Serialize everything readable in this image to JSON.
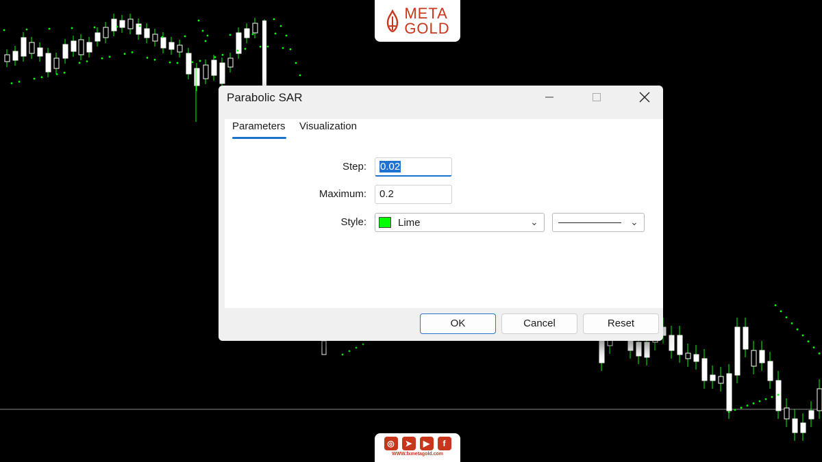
{
  "brand": {
    "logo_line1": "META",
    "logo_line2": "GOLD",
    "website": "WWW.fxmetagold.com",
    "accent": "#c8361c"
  },
  "social_icons": [
    "instagram-icon",
    "telegram-icon",
    "youtube-icon",
    "facebook-icon"
  ],
  "dialog": {
    "title": "Parabolic SAR",
    "tabs": [
      "Parameters",
      "Visualization"
    ],
    "active_tab": "Parameters",
    "fields": {
      "step_label": "Step:",
      "step_value": "0.02",
      "maximum_label": "Maximum:",
      "maximum_value": "0.2",
      "style_label": "Style:",
      "style_color_name": "Lime",
      "style_color": "#00ff00"
    },
    "buttons": {
      "ok": "OK",
      "cancel": "Cancel",
      "reset": "Reset"
    }
  },
  "chart_colors": {
    "candle": "#ffffff",
    "wick_and_sar": "#00ff00",
    "background": "#000000",
    "gridline": "#8a8a8a"
  }
}
